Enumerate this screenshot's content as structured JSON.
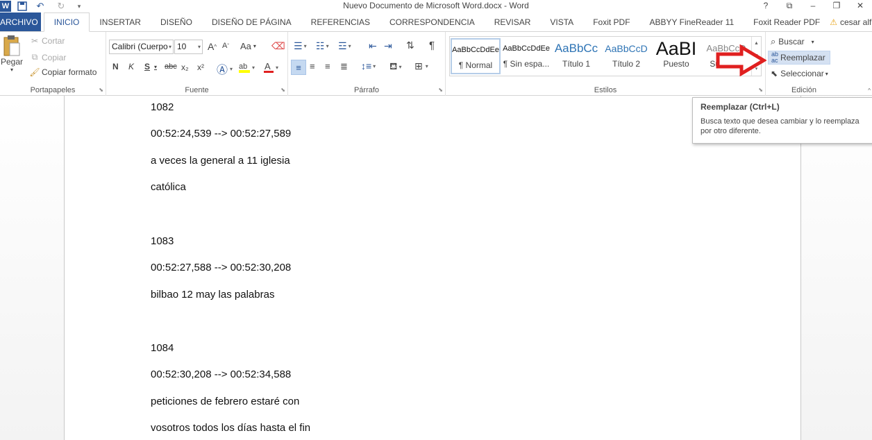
{
  "window": {
    "title": "Nuevo Documento de Microsoft Word.docx - Word",
    "controls": [
      "?",
      "⧉",
      "–",
      "❐",
      "✕"
    ]
  },
  "qat": {
    "logo": "W"
  },
  "tabs": [
    {
      "label": "ARCHIVO"
    },
    {
      "label": "INICIO"
    },
    {
      "label": "INSERTAR"
    },
    {
      "label": "DISEÑO"
    },
    {
      "label": "DISEÑO DE PÁGINA"
    },
    {
      "label": "REFERENCIAS"
    },
    {
      "label": "CORRESPONDENCIA"
    },
    {
      "label": "REVISAR"
    },
    {
      "label": "VISTA"
    },
    {
      "label": "Foxit PDF"
    },
    {
      "label": "ABBYY FineReader 11"
    },
    {
      "label": "Foxit Reader PDF"
    }
  ],
  "user": {
    "name": "cesar alfredo..."
  },
  "ribbon": {
    "portapapeles": {
      "label": "Portapapeles",
      "pegar": "Pegar",
      "cortar": "Cortar",
      "copiar": "Copiar",
      "copiar_formato": "Copiar formato"
    },
    "fuente": {
      "label": "Fuente",
      "font_name": "Calibri (Cuerpo",
      "font_size": "10",
      "bold": "N",
      "italic": "K",
      "underline": "S",
      "strike": "abc",
      "sub": "x₂",
      "sup": "x²",
      "grow": "A",
      "shrink": "A",
      "case": "Aa"
    },
    "parrafo": {
      "label": "Párrafo",
      "pilcrow": "¶"
    },
    "estilos": {
      "label": "Estilos",
      "items": [
        {
          "preview": "AaBbCcDdEe",
          "name": "¶ Normal"
        },
        {
          "preview": "AaBbCcDdEe",
          "name": "¶ Sin espa..."
        },
        {
          "preview": "AaBbCc",
          "name": "Título 1"
        },
        {
          "preview": "AaBbCcD",
          "name": "Título 2"
        },
        {
          "preview": "AaBI",
          "name": "Puesto"
        },
        {
          "preview": "AaBbCcD",
          "name": "Subtítulo"
        }
      ]
    },
    "edicion": {
      "label": "Edición",
      "buscar": "Buscar",
      "reemplazar": "Reemplazar",
      "seleccionar": "Seleccionar"
    }
  },
  "tooltip": {
    "title": "Reemplazar (Ctrl+L)",
    "body_line1": "Busca texto que desea cambiar y lo reemplaza",
    "body_line2": "por otro diferente."
  },
  "document": {
    "lines": [
      "1082",
      "00:52:24,539 --> 00:52:27,589",
      "a veces la general a 11 iglesia",
      "católica",
      "1083",
      "00:52:27,588 --> 00:52:30,208",
      "bilbao 12 may las palabras",
      "1084",
      "00:52:30,208 --> 00:52:34,588",
      "peticiones de febrero estaré con",
      "vosotros todos los días hasta el fin"
    ]
  },
  "colors": {
    "accent": "#2b579a",
    "arrow": "#e02020",
    "hover": "#d5e1f2"
  }
}
